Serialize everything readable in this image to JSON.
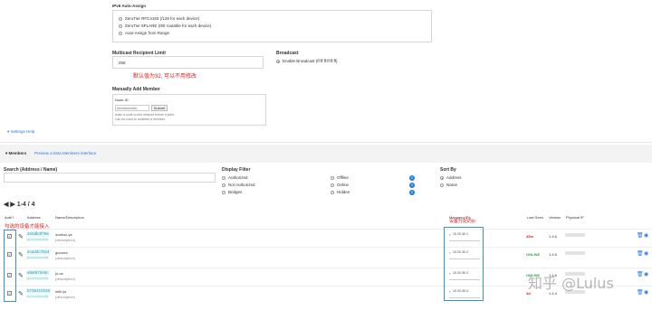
{
  "ipv6_assign": {
    "label": "IPv6 Auto-Assign",
    "options": [
      {
        "label": "ZeroTier RFC4193 (/128 for each device)",
        "checked": false
      },
      {
        "label": "ZeroTier 6PLANE (/80 routable for each device)",
        "checked": false
      },
      {
        "label": "Auto-Assign from Range",
        "checked": false
      }
    ]
  },
  "multicast": {
    "label": "Multicast Recipient Limit",
    "value": "256",
    "annotation": "默认值为32, 可以不用修改"
  },
  "broadcast": {
    "label": "Broadcast",
    "option": "Enable Broadcast (ff:ff:ff:ff:ff:ff)",
    "checked": true
  },
  "manual_add": {
    "title": "Manually Add Member",
    "node_id_label": "Node ID",
    "node_id_placeholder": "##########",
    "submit_label": "Submit",
    "help_line1": "Adds a node to this network before it joins.",
    "help_line2": "Can be used to undelete a member."
  },
  "settings_help": "Settings Help",
  "members_header": {
    "title": "Members",
    "preview_link": "Preview a beta Members interface"
  },
  "search": {
    "label": "Search (Address / Name)",
    "value": ""
  },
  "display_filter": {
    "label": "Display Filter",
    "col1": [
      {
        "label": "Authorized",
        "checked": false
      },
      {
        "label": "Not Authorized",
        "checked": false
      },
      {
        "label": "Bridges",
        "checked": false
      }
    ],
    "col2": [
      {
        "label": "Offline",
        "checked": false,
        "count": "0"
      },
      {
        "label": "Online",
        "checked": false,
        "count": "0"
      },
      {
        "label": "Hidden",
        "checked": false,
        "count": "0"
      }
    ]
  },
  "sort_by": {
    "label": "Sort By",
    "options": [
      {
        "label": "Address",
        "checked": true
      },
      {
        "label": "Name",
        "checked": false
      }
    ]
  },
  "pagination": {
    "text": "1-4 / 4"
  },
  "table": {
    "headers": {
      "auth": "Auth?",
      "address": "Address",
      "name": "Name/Description",
      "managed_ips": "Managed IPs",
      "last_seen": "Last Seen",
      "version": "Version",
      "physical_ip": "Physical IP"
    },
    "annotation_auth": "勾选的设备才能接入",
    "annotation_ip": "设备分配的ip",
    "rows": [
      {
        "address": "2e0db4f756",
        "mac": "ab:cd:12:34:ef:56",
        "name": "oueboo-ys",
        "desc": "(description)",
        "ip": "10.20.30.1",
        "last_seen": "45m",
        "last_seen_color": "#e02020",
        "version": "1.4.6"
      },
      {
        "address": "4cad2c7824",
        "mac": "ab:cd:12:34:ef:56",
        "name": "gooolcx",
        "desc": "(description)",
        "ip": "10.20.30.2",
        "last_seen": "ONLINE",
        "last_seen_color": "#2fa84f",
        "version": "1.4.6"
      },
      {
        "address": "afa8572e5c",
        "mac": "ab:cd:12:34:ef:56",
        "name": "jo-os",
        "desc": "(description)",
        "ip": "10.20.30.3",
        "last_seen": "ONLINE",
        "last_seen_color": "#2fa84f",
        "version": "1.4.6"
      },
      {
        "address": "b735410318",
        "mac": "ab:cd:12:34:ef:56",
        "name": "milk.ys",
        "desc": "(description)",
        "ip": "10.20.30.4",
        "last_seen": "4d",
        "last_seen_color": "#e02020",
        "version": "1.4.4"
      }
    ]
  },
  "watermark": "知乎 @Lulus"
}
